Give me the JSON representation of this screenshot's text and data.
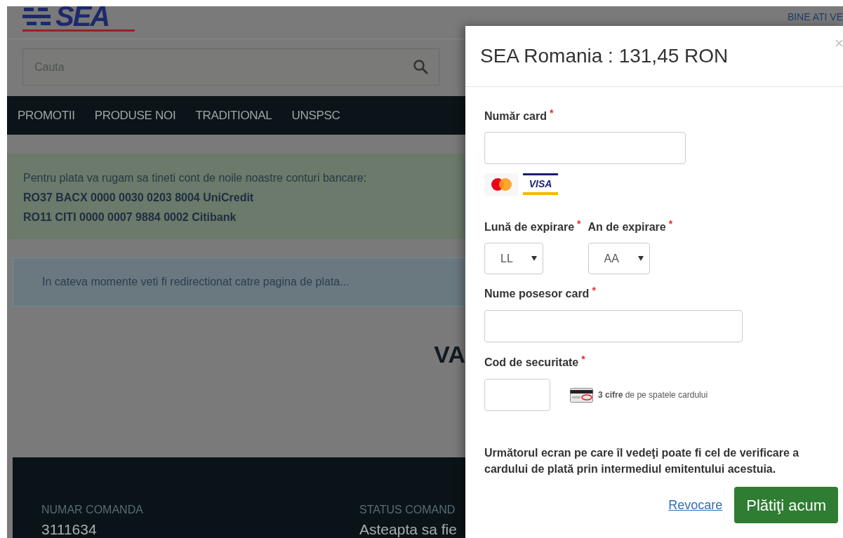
{
  "header": {
    "logo_text": "SEA",
    "greeting": "BINE ATI VE"
  },
  "search": {
    "placeholder": "Cauta"
  },
  "nav": [
    {
      "label": "PROMOTII"
    },
    {
      "label": "PRODUSE NOI"
    },
    {
      "label": "TRADITIONAL"
    },
    {
      "label": "UNSPSC"
    }
  ],
  "bank_notice": {
    "intro": "Pentru plata va rugam sa tineti cont de noile noastre conturi bancare:",
    "accounts": [
      "RO37 BACX 0000 0030 0203 8004 UniCredit",
      "RO11 CITI 0000 0007 9884 0002 Citibank"
    ]
  },
  "redirect_notice": "In cateva momente veti fi redirectionat catre pagina de plata...",
  "heading": "VA",
  "order": [
    {
      "label": "NUMAR COMANDA",
      "value": "3111634"
    },
    {
      "label": "STATUS COMAND",
      "value": "Asteapta sa fie"
    }
  ],
  "modal": {
    "title": "SEA Romania : 131,45 RON",
    "close": "×",
    "card_number": {
      "label": "Număr card",
      "mark": "*"
    },
    "accepted_cards": [
      {
        "kind": "mastercard"
      },
      {
        "kind": "visa",
        "text": "VISA"
      }
    ],
    "expiry": [
      {
        "label": "Lună de expirare",
        "mark": "*",
        "value": "LL"
      },
      {
        "label": "An de expirare",
        "mark": "*",
        "value": "AA"
      }
    ],
    "holder": {
      "label": "Nume posesor card",
      "mark": "*"
    },
    "cvv": {
      "label": "Cod de securitate",
      "mark": "*",
      "hint": "**3 cifre** de pe spatele cardului"
    },
    "note": "Următorul ecran pe care îl vedeţi poate fi cel de verificare a cardului de plată prin intermediul emitentului acestuia.",
    "cancel": "Revocare",
    "submit": "Plătiţi acum"
  }
}
